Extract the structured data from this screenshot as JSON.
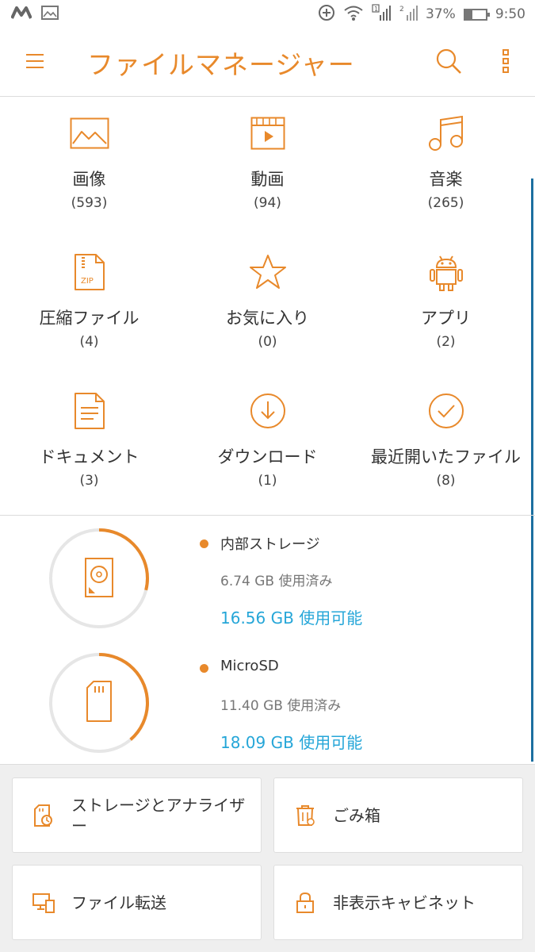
{
  "status_bar": {
    "battery": "37%",
    "time": "9:50",
    "battery_level": 0.37
  },
  "app_bar": {
    "title": "ファイルマネージャー"
  },
  "categories": [
    {
      "label": "画像",
      "count": "(593)",
      "icon": "image-icon"
    },
    {
      "label": "動画",
      "count": "(94)",
      "icon": "video-icon"
    },
    {
      "label": "音楽",
      "count": "(265)",
      "icon": "music-icon"
    },
    {
      "label": "圧縮ファイル",
      "count": "(4)",
      "icon": "zip-icon"
    },
    {
      "label": "お気に入り",
      "count": "(0)",
      "icon": "star-icon"
    },
    {
      "label": "アプリ",
      "count": "(2)",
      "icon": "android-icon"
    },
    {
      "label": "ドキュメント",
      "count": "(3)",
      "icon": "document-icon"
    },
    {
      "label": "ダウンロード",
      "count": "(1)",
      "icon": "download-icon"
    },
    {
      "label": "最近開いたファイル",
      "count": "(8)",
      "icon": "recent-icon"
    }
  ],
  "storage": [
    {
      "name": "内部ストレージ",
      "used": "6.74 GB 使用済み",
      "free": "16.56 GB 使用可能",
      "used_fraction": 0.289
    },
    {
      "name": "MicroSD",
      "used": "11.40 GB 使用済み",
      "free": "18.09 GB 使用可能",
      "used_fraction": 0.387
    }
  ],
  "tools": [
    {
      "label": "ストレージとアナライザー",
      "icon": "storage-analyzer-icon"
    },
    {
      "label": "ごみ箱",
      "icon": "trash-icon"
    },
    {
      "label": "ファイル転送",
      "icon": "file-transfer-icon"
    },
    {
      "label": "非表示キャビネット",
      "icon": "lock-icon"
    }
  ],
  "colors": {
    "accent": "#e8892b",
    "free_text": "#25a6d8",
    "ring_track": "#e6e6e6"
  }
}
